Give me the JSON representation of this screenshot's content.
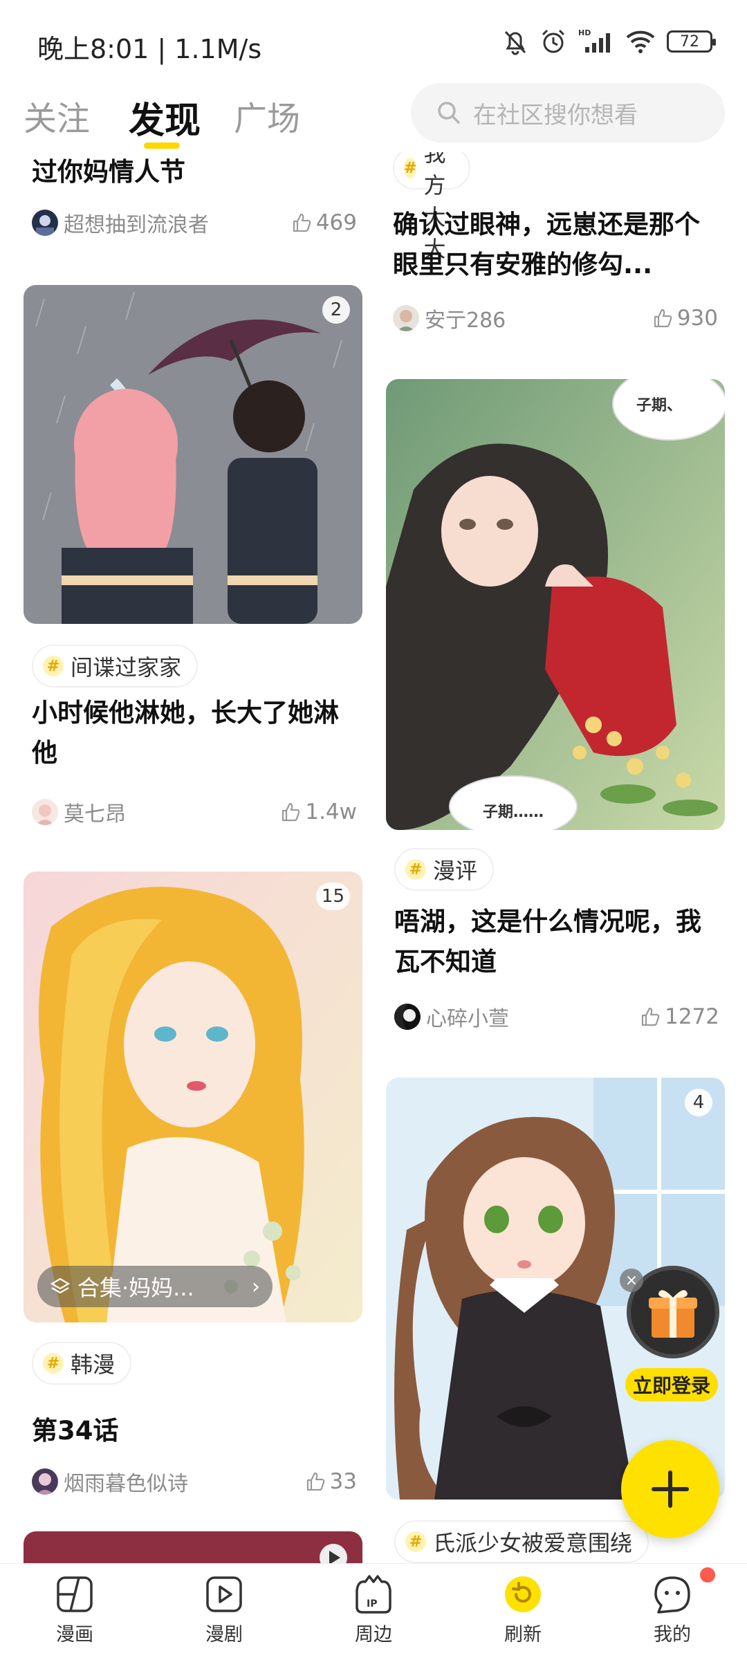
{
  "status_bar": {
    "time": "晚上8:01 | 1.1M/s",
    "battery": "72",
    "icons": [
      "mute-bell-icon",
      "alarm-icon",
      "hd-signal-icon",
      "wifi-icon",
      "battery-icon"
    ]
  },
  "top_nav": {
    "tabs": [
      {
        "label": "关注",
        "active": false
      },
      {
        "label": "发现",
        "active": true
      },
      {
        "label": "广场",
        "active": false
      }
    ],
    "search_placeholder": "在社区搜你想看"
  },
  "feed": {
    "left": [
      {
        "title": "过你妈情人节",
        "author": "超想抽到流浪者",
        "likes": "469"
      },
      {
        "image_count": "2",
        "tag": "间谍过家家",
        "title": "小时候他淋她，长大了她淋他",
        "author": "莫七昂",
        "likes": "1.4w"
      },
      {
        "image_count": "15",
        "collection": "合集·妈妈...",
        "tag": "韩漫",
        "title": "第34话",
        "author": "烟雨暮色似诗",
        "likes": "33"
      }
    ],
    "right": [
      {
        "tag": "保护我方大大",
        "title": "确认过眼神，远崽还是那个眼里只有安雅的修勾...",
        "author": "安亍286",
        "likes": "930"
      },
      {
        "bubble_top": "子期、",
        "bubble_bottom": "子期……",
        "tag": "漫评",
        "title": "唔湖，这是什么情况呢，我瓦不知道",
        "author": "心碎小萱",
        "likes": "1272"
      },
      {
        "image_count": "4",
        "tag": "氏派少女被爱意围绕"
      }
    ]
  },
  "floating": {
    "login_label": "立即登录",
    "close_glyph": "×"
  },
  "bottom_nav": {
    "items": [
      {
        "label": "漫画",
        "icon": "comic-icon"
      },
      {
        "label": "漫剧",
        "icon": "play-icon"
      },
      {
        "label": "周边",
        "icon": "ip-merch-icon"
      },
      {
        "label": "刷新",
        "icon": "refresh-icon"
      },
      {
        "label": "我的",
        "icon": "profile-icon"
      }
    ]
  },
  "colors": {
    "accent": "#ffd600",
    "text_primary": "#111111",
    "text_secondary": "#8b8b8b",
    "notification": "#ff5a4e"
  }
}
